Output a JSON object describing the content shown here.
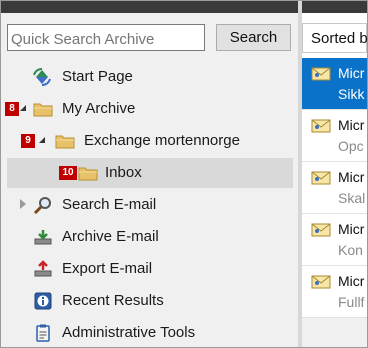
{
  "search": {
    "placeholder": "Quick Search Archive",
    "button_label": "Search"
  },
  "tree": {
    "start_page": "Start Page",
    "my_archive": {
      "label": "My Archive",
      "badge": "8"
    },
    "exchange": {
      "label": "Exchange mortennorge",
      "badge": "9"
    },
    "inbox": {
      "label": "Inbox",
      "badge": "10"
    },
    "search_email": "Search E-mail",
    "archive_email": "Archive E-mail",
    "export_email": "Export E-mail",
    "recent_results": "Recent Results",
    "admin_tools": "Administrative Tools"
  },
  "list": {
    "sort_label": "Sorted b",
    "emails": [
      {
        "from": "Micr",
        "subject": "Sikk",
        "selected": true
      },
      {
        "from": "Micr",
        "subject": "Opc"
      },
      {
        "from": "Micr",
        "subject": "Skal"
      },
      {
        "from": "Micr",
        "subject": "Kon"
      },
      {
        "from": "Micr",
        "subject": "Fullf"
      }
    ]
  },
  "colors": {
    "selection_blue": "#0a73c9",
    "badge_red": "#c00000",
    "tree_selected": "#d9d9d9",
    "panel_bg": "#f0f0f0"
  }
}
